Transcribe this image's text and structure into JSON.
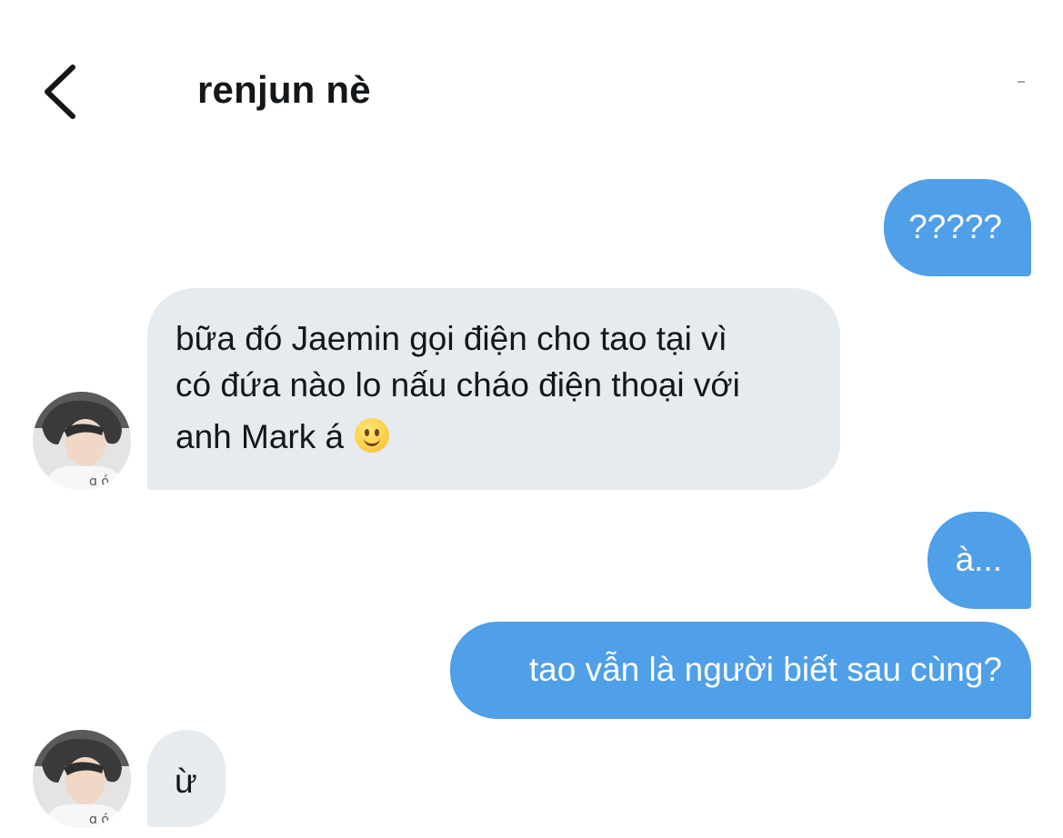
{
  "header": {
    "title": "renjun nè",
    "back_icon": "chevron-left-icon"
  },
  "colors": {
    "outgoing_bubble": "#4f9fe9",
    "incoming_bubble": "#e6ebef",
    "text_dark": "#14171a"
  },
  "messages": [
    {
      "direction": "outgoing",
      "text": "?????"
    },
    {
      "direction": "incoming",
      "lines": [
        "bữa đó Jaemin gọi điện cho tao tại vì",
        "có đứa nào lo nấu cháo điện thoại với",
        "anh Mark á"
      ],
      "emoji": "slightly-smiling-face"
    },
    {
      "direction": "outgoing",
      "text": "à..."
    },
    {
      "direction": "outgoing",
      "text": "tao vẫn là người biết sau cùng?"
    },
    {
      "direction": "incoming",
      "text": "ừ"
    }
  ]
}
